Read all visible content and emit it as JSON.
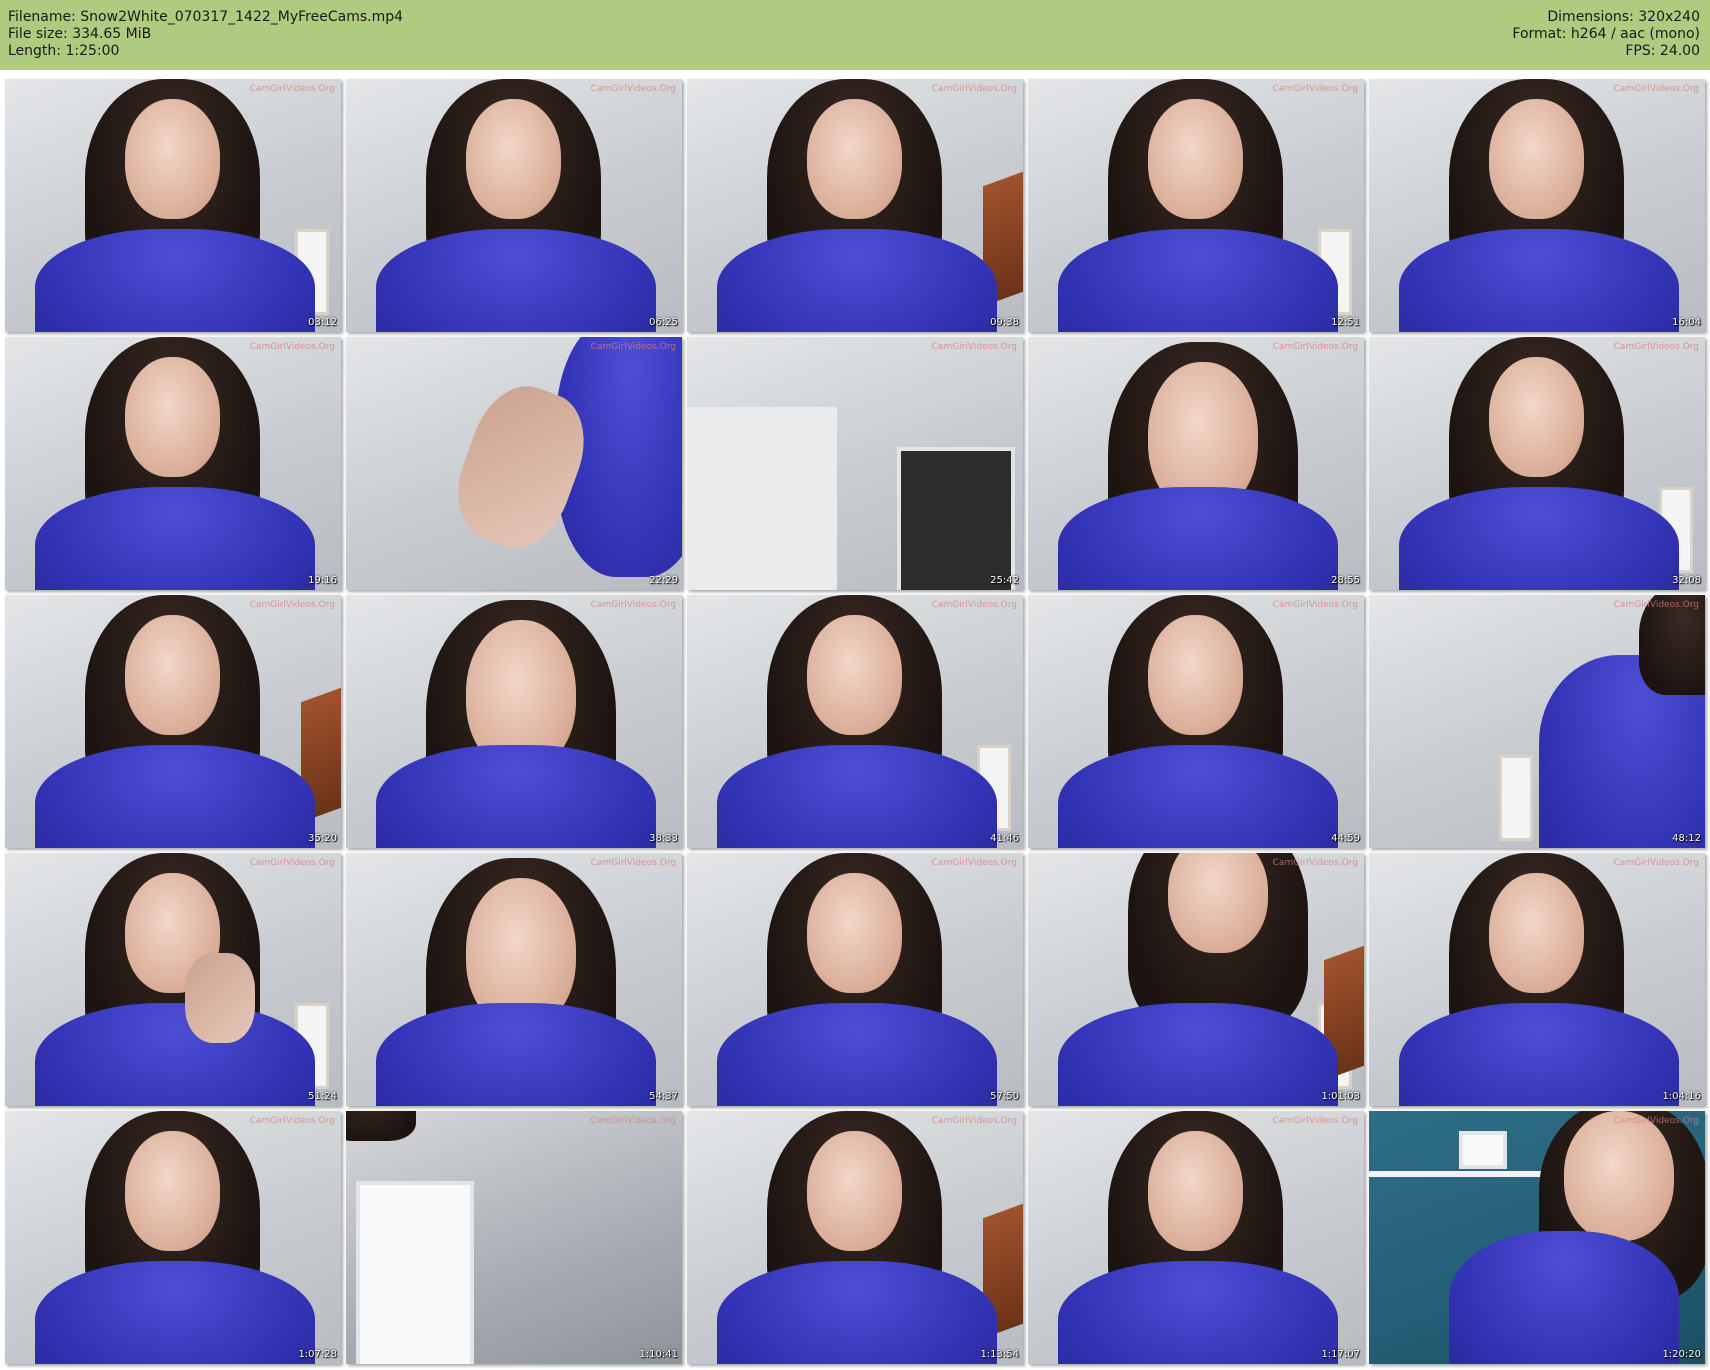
{
  "header": {
    "filename": "Filename: Snow2White_070317_1422_MyFreeCams.mp4",
    "filesize": "File size: 334.65 MiB",
    "length": "Length: 1:25:00",
    "dimensions": "Dimensions: 320x240",
    "format": "Format: h264 / aac (mono)",
    "fps": "FPS: 24.00"
  },
  "colors": {
    "header_bg": "#aecb80",
    "shirt": "#3434b8",
    "timestamp": "#ffffff"
  },
  "watermark": "CamGirlVideos.Org",
  "thumbnails": [
    {
      "time": "03:12"
    },
    {
      "time": "06:25"
    },
    {
      "time": "09:38"
    },
    {
      "time": "12:51"
    },
    {
      "time": "16:04"
    },
    {
      "time": "19:16"
    },
    {
      "time": "22:29"
    },
    {
      "time": "25:42"
    },
    {
      "time": "28:55"
    },
    {
      "time": "32:08"
    },
    {
      "time": "35:20"
    },
    {
      "time": "38:33"
    },
    {
      "time": "41:46"
    },
    {
      "time": "44:59"
    },
    {
      "time": "48:12"
    },
    {
      "time": "51:24"
    },
    {
      "time": "54:37"
    },
    {
      "time": "57:50"
    },
    {
      "time": "1:01:03"
    },
    {
      "time": "1:04:16"
    },
    {
      "time": "1:07:28"
    },
    {
      "time": "1:10:41"
    },
    {
      "time": "1:13:54"
    },
    {
      "time": "1:17:07"
    },
    {
      "time": "1:20:20"
    }
  ]
}
